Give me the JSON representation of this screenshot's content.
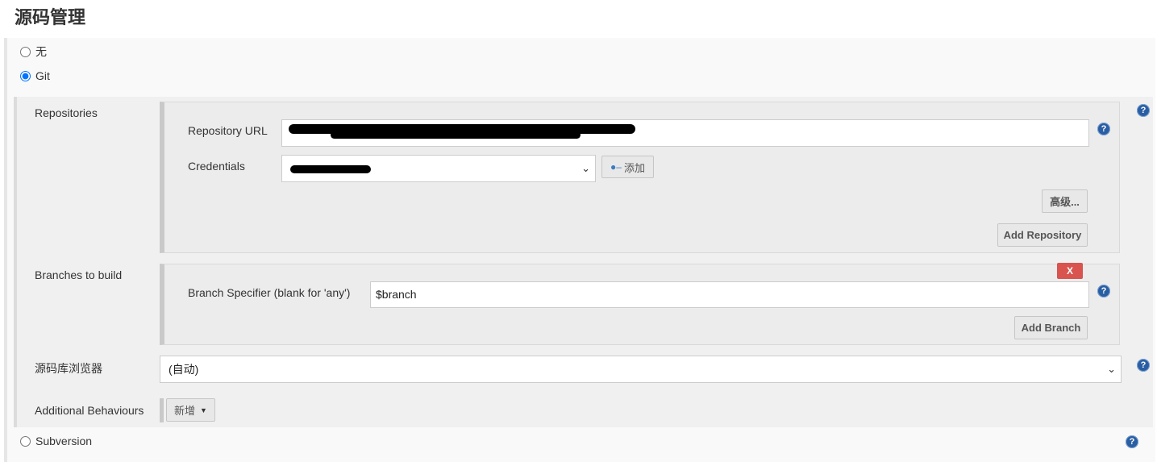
{
  "section": {
    "title": "源码管理"
  },
  "scm_options": {
    "none_label": "无",
    "git_label": "Git",
    "subversion_label": "Subversion",
    "selected": "Git"
  },
  "repositories": {
    "label": "Repositories",
    "url_label": "Repository URL",
    "credentials_label": "Credentials",
    "add_credentials_label": "添加",
    "advanced_label": "高级...",
    "add_repository_label": "Add Repository"
  },
  "branches": {
    "label": "Branches to build",
    "specifier_label": "Branch Specifier (blank for 'any')",
    "specifier_value": "$branch",
    "delete_label": "X",
    "add_branch_label": "Add Branch"
  },
  "browser": {
    "label": "源码库浏览器",
    "selected": "(自动)"
  },
  "behaviours": {
    "label": "Additional Behaviours",
    "add_label": "新增"
  },
  "icons": {
    "help": "help-icon",
    "key": "key-icon",
    "chevron": "chevron-down-icon"
  },
  "colors": {
    "help_icon": "#2a5ea3",
    "delete_button": "#d9534f"
  }
}
